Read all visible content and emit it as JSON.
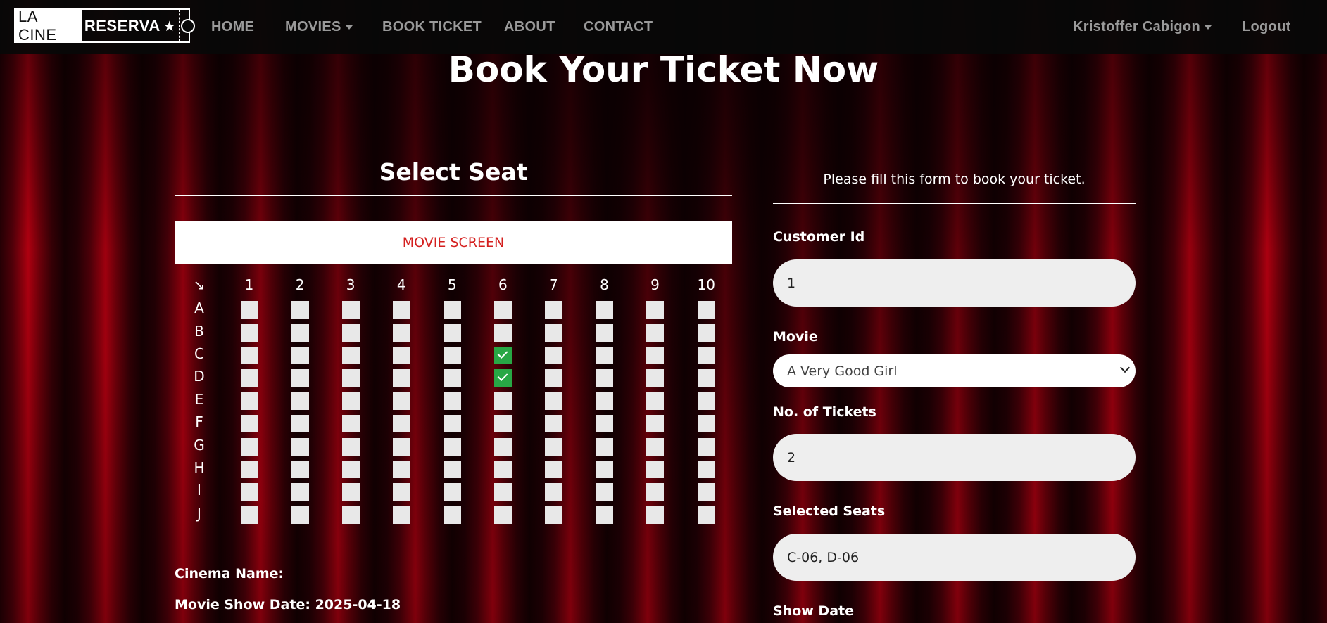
{
  "navbar": {
    "logo_left": "LA CINE",
    "logo_right": "RESERVA",
    "logo_star": "★",
    "items": [
      "HOME",
      "MOVIES",
      "BOOK TICKET",
      "ABOUT",
      "CONTACT"
    ],
    "user_name": "Kristoffer Cabigon",
    "logout": "Logout"
  },
  "page": {
    "title": "Book Your Ticket Now"
  },
  "seat_section": {
    "title": "Select Seat",
    "screen_label": "MOVIE SCREEN",
    "corner": "↘",
    "columns": [
      "1",
      "2",
      "3",
      "4",
      "5",
      "6",
      "7",
      "8",
      "9",
      "10"
    ],
    "rows": [
      "A",
      "B",
      "C",
      "D",
      "E",
      "F",
      "G",
      "H",
      "I",
      "J"
    ],
    "selected": [
      "C-06",
      "D-06"
    ],
    "colors": {
      "seat": "#e8e8e8",
      "selected": "#28a745",
      "screen_text": "#d4201f"
    }
  },
  "info": {
    "cinema_name_label": "Cinema Name:",
    "show_date_label": "Movie Show Date: 2025-04-18"
  },
  "form": {
    "intro": "Please fill this form to book your ticket.",
    "customer_id_label": "Customer Id",
    "customer_id_value": "1",
    "movie_label": "Movie",
    "movie_value": "A Very Good Girl",
    "tickets_label": "No. of Tickets",
    "tickets_value": "2",
    "selected_seats_label": "Selected Seats",
    "selected_seats_value": "C-06, D-06",
    "show_date_label": "Show Date"
  }
}
